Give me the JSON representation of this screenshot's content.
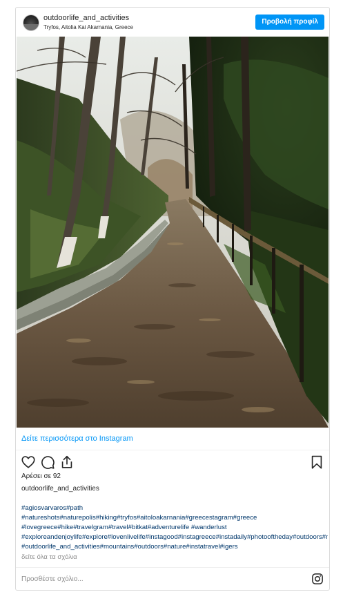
{
  "header": {
    "username": "outdoorlife_and_activities",
    "location": "Tryfos, Aitolia Kai Akarnania, Greece",
    "profile_button": "Προβολή προφίλ"
  },
  "more_link": "Δείτε περισσότερα στο Instagram",
  "actions": {
    "icons": [
      "heart-icon",
      "comment-icon",
      "share-icon",
      "bookmark-icon"
    ]
  },
  "likes": "Αρέσει σε 92",
  "author": "outdoorlife_and_activities",
  "caption_lines": [
    "#agiosvarvaros#path",
    "#natureshots#naturepolis#hiking#tryfos#aitoloakarnania#greecestagram#greece",
    "#lovegreece#hike#travelgram#travel#bitkat#adventurelife #wanderlust",
    "#exploreandenjoylife#explore#lovenlivelife#instagood#instagreece#instadaily#photooftheday#outdoors#nature",
    "#outdoorlife_and_activities#mountains#outdoors#nature#instatravel#igers"
  ],
  "view_all": "δείτε όλα τα σχόλια",
  "comment_placeholder": "Προσθέστε σχόλιο...",
  "colors": {
    "accent": "#0095f6",
    "hashtag": "#00376b",
    "muted": "#8e8e8e"
  }
}
